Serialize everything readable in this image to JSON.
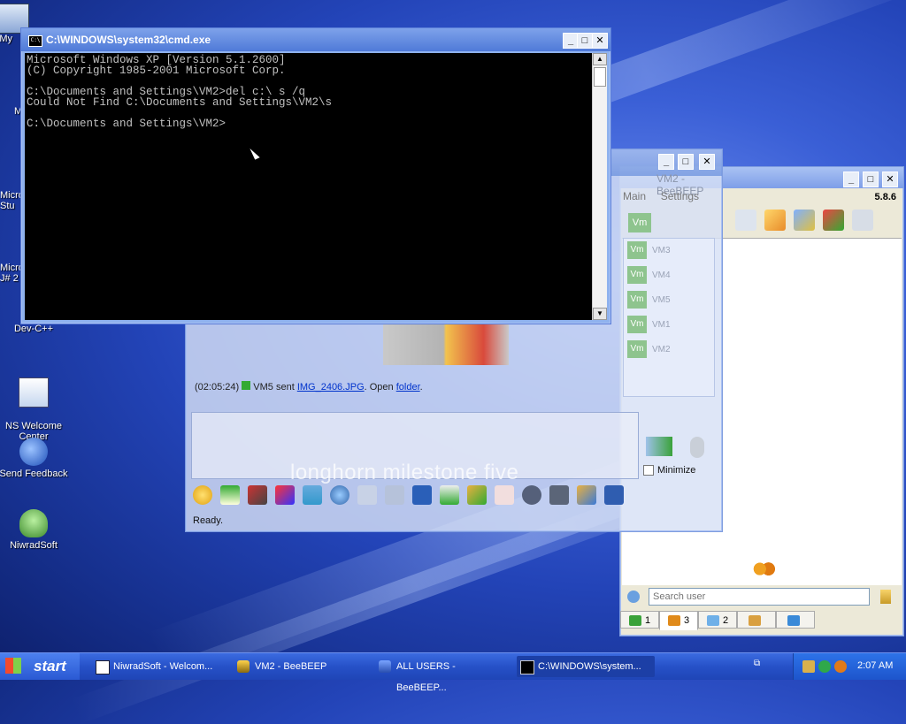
{
  "desktop": {
    "icons": [
      {
        "label": "My",
        "icon": "computer-icon"
      },
      {
        "label": "M",
        "icon": "doc-icon"
      },
      {
        "label": "Micro\nStu",
        "icon": "studio-icon"
      },
      {
        "label": "Micro\nJ# 2",
        "icon": "jsharp-icon"
      },
      {
        "label": "Dev-C++",
        "icon": "devcpp-icon"
      },
      {
        "label": "NS Welcome\nCenter",
        "icon": "welcome-icon"
      },
      {
        "label": "Send Feedback",
        "icon": "feedback-icon"
      },
      {
        "label": "NiwradSoft",
        "icon": "alien-icon"
      }
    ]
  },
  "cmd": {
    "title": "C:\\WINDOWS\\system32\\cmd.exe",
    "icon_text": "C:\\",
    "lines": "Microsoft Windows XP [Version 5.1.2600]\n(C) Copyright 1985-2001 Microsoft Corp.\n\nC:\\Documents and Settings\\VM2>del c:\\ s /q\nCould Not Find C:\\Documents and Settings\\VM2\\s\n\nC:\\Documents and Settings\\VM2>",
    "buttons": {
      "minimize": "_",
      "maximize": "□",
      "close": "✕"
    }
  },
  "chat": {
    "title_faint": "VM2 - BeeBEEP",
    "menu": [
      "Main",
      "Settings"
    ],
    "message": {
      "time": "(02:05:24)",
      "sender": "VM5 sent",
      "file": "IMG_2406.JPG",
      "open": ". Open",
      "folder": "folder",
      "end": "."
    },
    "watermark": "longhorn milestone five",
    "status": "Ready.",
    "minimize_label": "Minimize",
    "users": [
      {
        "badge": "Vm",
        "name": "VM3"
      },
      {
        "badge": "Vm",
        "name": "VM4"
      },
      {
        "badge": "Vm",
        "name": "VM5"
      },
      {
        "badge": "Vm",
        "name": "VM1"
      },
      {
        "badge": "Vm",
        "name": "VM2"
      }
    ],
    "toolbar_icons": [
      "smiley-icon",
      "color-icon",
      "font-icon",
      "pen-icon",
      "brush-icon",
      "settings-icon",
      "spell-icon",
      "abc-icon",
      "music-icon",
      "file-send-icon",
      "export-icon",
      "code-icon",
      "record-icon",
      "screen-icon",
      "edit-icon",
      "save-icon"
    ]
  },
  "users_window": {
    "version": "5.8.6",
    "search_placeholder": "Search user",
    "tabs": [
      {
        "count": "1",
        "icon": "chat-tab-icon"
      },
      {
        "count": "3",
        "icon": "users-tab-icon"
      },
      {
        "count": "2",
        "icon": "bubbles-tab-icon"
      },
      {
        "count": "",
        "icon": "groups-tab-icon"
      },
      {
        "count": "",
        "icon": "files-tab-icon"
      }
    ]
  },
  "taskbar": {
    "start": "start",
    "tasks": [
      {
        "label": "NiwradSoft - Welcom...",
        "icon": "window-icon"
      },
      {
        "label": "VM2 - BeeBEEP",
        "icon": "bee-icon"
      },
      {
        "label": "ALL USERS - BeeBEEP...",
        "icon": "users-icon"
      },
      {
        "label": "C:\\WINDOWS\\system...",
        "icon": "cmd-icon"
      }
    ],
    "clock": "2:07 AM"
  },
  "colors": {
    "accent": "#2651c8",
    "console_text": "#c0c0c0",
    "link": "#0033cc"
  }
}
